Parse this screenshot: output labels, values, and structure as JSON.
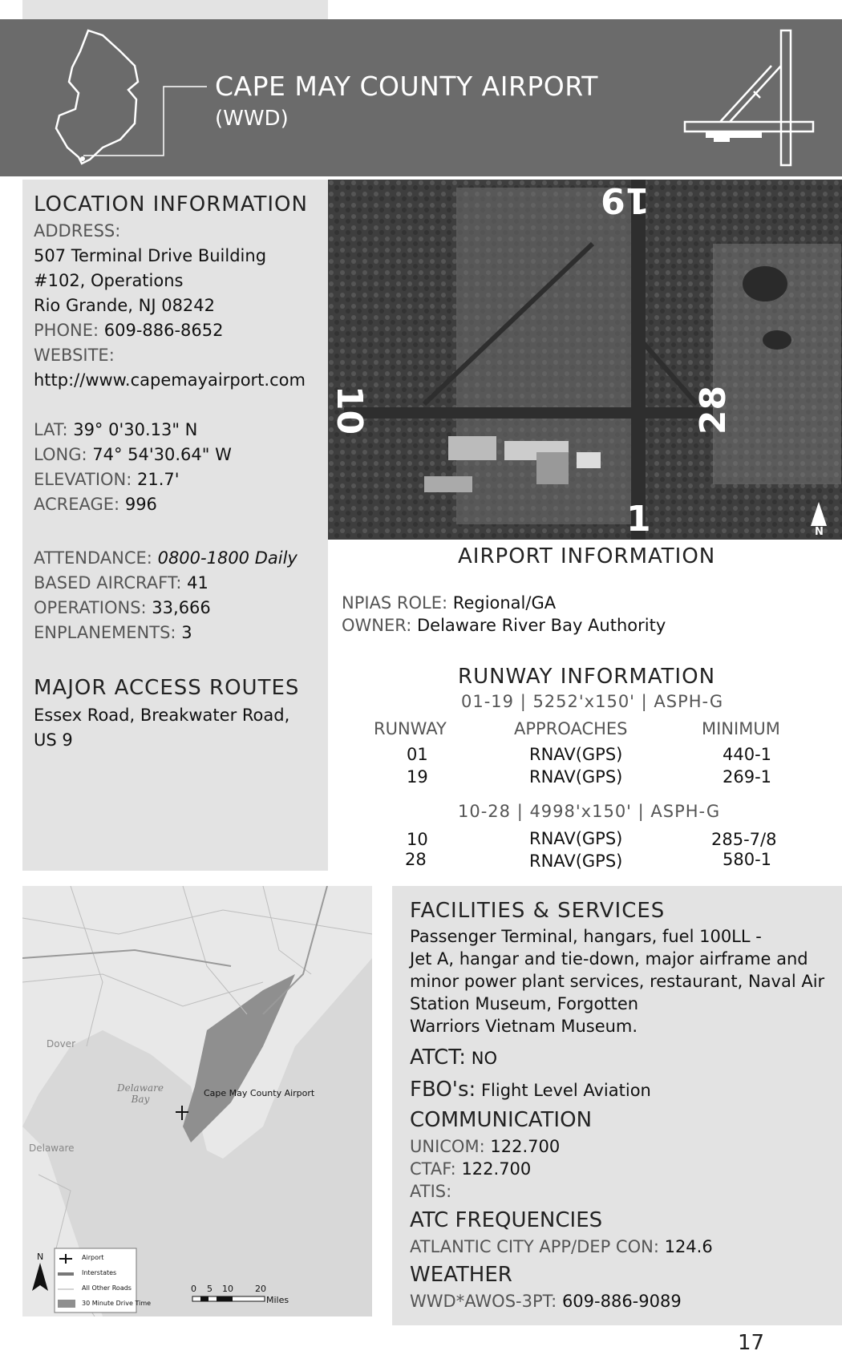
{
  "header": {
    "title": "CAPE MAY COUNTY AIRPORT",
    "code": "(WWD)"
  },
  "location": {
    "heading": "LOCATION  INFORMATION",
    "address_label": "ADDRESS:",
    "address_lines": [
      "507 Terminal Drive Building",
      "#102, Operations",
      "Rio Grande, NJ 08242"
    ],
    "phone_label": "PHONE:",
    "phone": "609-886-8652",
    "website_label": "WEBSITE:",
    "website": "http://www.capemayairport.com",
    "lat_label": "LAT:",
    "lat": "39° 0'30.13\" N",
    "long_label": "LONG:",
    "long": "74° 54'30.64\" W",
    "elev_label": "ELEVATION:",
    "elev": "21.7'",
    "acreage_label": "ACREAGE:",
    "acreage": "996",
    "attendance_label": "ATTENDANCE:",
    "attendance": "0800-1800 Daily",
    "based_label": "BASED AIRCRAFT:",
    "based": "41",
    "ops_label": "OPERATIONS:",
    "ops": "33,666",
    "enpl_label": "ENPLANEMENTS:",
    "enpl": "3"
  },
  "access": {
    "heading": "MAJOR ACCESS ROUTES",
    "lines": [
      "Essex Road, Breakwater Road,",
      "US 9"
    ]
  },
  "aerial": {
    "labels": [
      "19",
      "10",
      "28",
      "1"
    ],
    "north": "N"
  },
  "airport_info": {
    "heading": "AIRPORT  INFORMATION",
    "npias_label": "NPIAS  ROLE:",
    "npias": "Regional/GA",
    "owner_label": "OWNER:",
    "owner": "Delaware River Bay Authority"
  },
  "runway_info": {
    "heading": "RUNWAY  INFORMATION",
    "headers": [
      "RUNWAY",
      "APPROACHES",
      "MINIMUM"
    ],
    "groups": [
      {
        "spec": "01-19 | 5252'x150' | ASPH-G",
        "rows": [
          [
            "01",
            "RNAV(GPS)",
            "440-1"
          ],
          [
            "19",
            "RNAV(GPS)",
            "269-1"
          ]
        ]
      },
      {
        "spec": "10-28 | 4998'x150' | ASPH-G",
        "rows": [
          [
            "10",
            "RNAV(GPS)",
            "285-7/8"
          ],
          [
            "28",
            "RNAV(GPS)",
            "580-1"
          ]
        ]
      }
    ]
  },
  "map": {
    "airport_label": "Cape May County Airport",
    "place_dover": "Dover",
    "place_bay": "Delaware\nBay",
    "place_delaware": "Delaware",
    "north": "N",
    "legend": [
      "Airport",
      "Interstates",
      "All Other Roads",
      "30 Minute Drive Time"
    ],
    "scale_ticks": [
      "0",
      "5",
      "10",
      "20"
    ],
    "scale_unit": "Miles"
  },
  "facilities": {
    "heading": "FACILITIES & SERVICES",
    "lines": [
      "Passenger  Terminal,  hangars,  fuel  100LL  -",
      "Jet A,  hangar and tie-down, major airframe  and",
      "minor power plant services, restaurant, Naval Air",
      "Station  Museum,  Forgotten",
      "Warriors  Vietnam  Museum."
    ],
    "atct_label": "ATCT:",
    "atct": "NO",
    "fbo_label": "FBO's:",
    "fbo": "Flight Level Aviation",
    "comm_heading": "COMMUNICATION",
    "unicom_label": "UNICOM:",
    "unicom": "122.700",
    "ctaf_label": "CTAF:",
    "ctaf": "122.700",
    "atis_label": "ATIS:",
    "atc_heading": "ATC FREQUENCIES",
    "atc_label": "ATLANTIC  CITY  APP/DEP  CON:",
    "atc": "124.6",
    "weather_heading": "WEATHER",
    "weather_label": "WWD*AWOS-3PT:",
    "weather": "609-886-9089"
  },
  "page_number": "17"
}
